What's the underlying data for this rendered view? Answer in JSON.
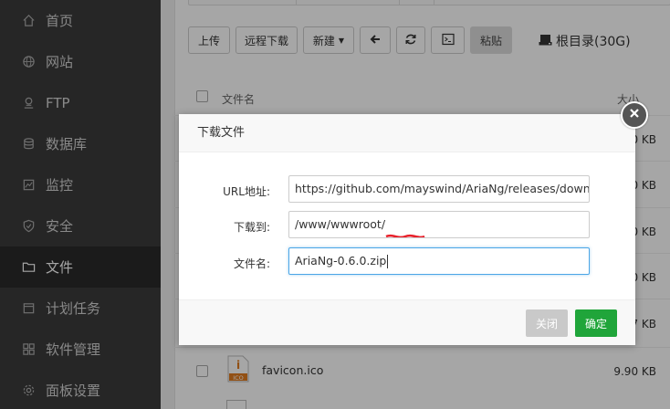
{
  "sidebar": {
    "items": [
      {
        "label": "首页",
        "icon": "home-icon"
      },
      {
        "label": "网站",
        "icon": "globe-icon"
      },
      {
        "label": "FTP",
        "icon": "ftp-icon"
      },
      {
        "label": "数据库",
        "icon": "database-icon"
      },
      {
        "label": "监控",
        "icon": "monitor-icon"
      },
      {
        "label": "安全",
        "icon": "shield-icon"
      },
      {
        "label": "文件",
        "icon": "folder-icon",
        "active": true
      },
      {
        "label": "计划任务",
        "icon": "calendar-icon"
      },
      {
        "label": "软件管理",
        "icon": "grid-icon"
      },
      {
        "label": "面板设置",
        "icon": "gear-icon"
      }
    ]
  },
  "toolbar": {
    "upload": "上传",
    "remote_download": "远程下载",
    "new": "新建",
    "paste": "粘贴",
    "root": "根目录(30G)"
  },
  "table": {
    "header_name": "文件名",
    "header_size": "大小",
    "rows": [
      {
        "size": "0 KB"
      },
      {
        "size": "0 KB"
      },
      {
        "size": "0 KB"
      },
      {
        "size": "0 KB"
      },
      {
        "size": "7 KB"
      },
      {
        "name": "favicon.ico",
        "size": "9.90 KB",
        "icon_label": "ICO"
      }
    ]
  },
  "dialog": {
    "title": "下载文件",
    "url_label": "URL地址:",
    "url_value": "https://github.com/mayswind/AriaNg/releases/downloa",
    "dest_label": "下载到:",
    "dest_value": "/www/wwwroot/",
    "filename_label": "文件名:",
    "filename_value": "AriaNg-0.6.0.zip",
    "close_button": "关闭",
    "ok_button": "确定"
  },
  "colors": {
    "sidebar_bg": "#3b3b3b",
    "ok_green": "#20a53a",
    "focus_blue": "#4ca6e6",
    "redaction_red": "#e8202a"
  }
}
